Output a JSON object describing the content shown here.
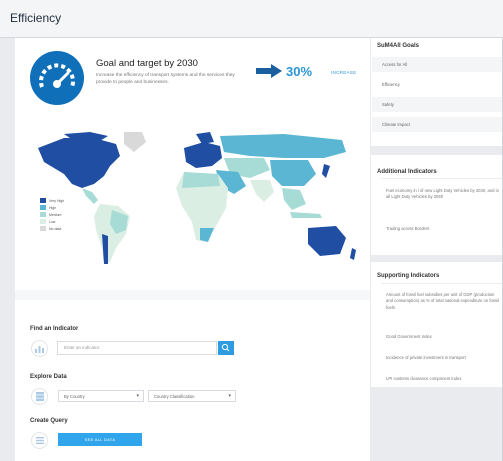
{
  "header": {
    "title": "Efficiency"
  },
  "hero": {
    "title": "Goal and target by 2030",
    "description": "Increase the efficiency of transport systems and the services they provide to people and businesses.",
    "target_value": "30%",
    "target_word": "INCREASE"
  },
  "map": {
    "legend": [
      {
        "label": "Very High",
        "color": "#1f4ea3"
      },
      {
        "label": "High",
        "color": "#5bb6d4"
      },
      {
        "label": "Medium",
        "color": "#a6dcd5"
      },
      {
        "label": "Low",
        "color": "#dbeee4"
      },
      {
        "label": "No data",
        "color": "#d9d9d9"
      }
    ]
  },
  "tools": {
    "find_label": "Find an Indicator",
    "search_placeholder": "Enter an indicator",
    "explore_label": "Explore Data",
    "select_country": "By Country",
    "select_classification": "Country Classification",
    "create_label": "Create Query",
    "query_button": "SEE ALL DATA"
  },
  "goals": {
    "title": "SuM4All Goals",
    "items": [
      "Access for All",
      "Efficiency",
      "Safety",
      "Climate Impact"
    ],
    "active_index": 1
  },
  "additional": {
    "title": "Additional Indicators",
    "items": [
      "Fuel economy in l of new Light Duty Vehicles by 2030, and in all Light Duty Vehicles by 2050",
      "Trading across Borders"
    ]
  },
  "supporting": {
    "title": "Supporting Indicators",
    "items": [
      "Amount of fossil fuel subsidies per unit of GDP (production and consumption) as % of total national expenditure on fossil fuels",
      "Good Government Index",
      "Incidence of private investment in transport",
      "LPI customs clearance component index"
    ]
  },
  "colors": {
    "accent": "#2d9ce0",
    "brand_blue": "#0f6fb8",
    "land_no_data": "#d9d9d9"
  }
}
